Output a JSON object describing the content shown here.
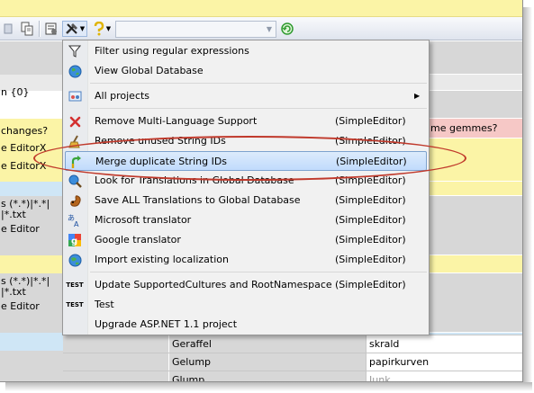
{
  "toolbar": {
    "combo_value": ""
  },
  "grid_left_texts": [
    "n {0}",
    "changes?",
    "e EditorX",
    "e EditorX",
    "s (*.*)|*.*|",
    "|*.txt",
    "e Editor",
    "s (*.*)|*.*|",
    "|*.txt",
    "e Editor"
  ],
  "right_column_text": "me gemmes?",
  "menu": {
    "items": [
      {
        "label": "Filter using regular expressions",
        "icon": "filter-icon",
        "shortcut": ""
      },
      {
        "label": "View Global Database",
        "icon": "globe-icon",
        "shortcut": ""
      },
      {
        "label": "All projects",
        "icon": "projects-icon",
        "shortcut": ""
      },
      {
        "label": "Remove Multi-Language Support",
        "icon": "red-x-icon",
        "shortcut": "(SimpleEditor)"
      },
      {
        "label": "Remove unused String IDs",
        "icon": "broom-icon",
        "shortcut": "(SimpleEditor)"
      },
      {
        "label": "Merge duplicate String IDs",
        "icon": "merge-arrow-icon",
        "shortcut": "(SimpleEditor)"
      },
      {
        "label": "Look for Translations in Global Database",
        "icon": "search-globe-icon",
        "shortcut": "(SimpleEditor)"
      },
      {
        "label": "Save ALL Translations to Global Database",
        "icon": "squirrel-icon",
        "shortcut": "(SimpleEditor)"
      },
      {
        "label": "Microsoft translator",
        "icon": "translate-icon",
        "shortcut": "(SimpleEditor)"
      },
      {
        "label": "Google translator",
        "icon": "google-icon",
        "shortcut": "(SimpleEditor)"
      },
      {
        "label": "Import existing localization",
        "icon": "import-globe-icon",
        "shortcut": "(SimpleEditor)"
      },
      {
        "label": "Update SupportedCultures and RootNamespace",
        "icon": "test-icon",
        "shortcut": "(SimpleEditor)"
      },
      {
        "label": "Test",
        "icon": "test-icon",
        "shortcut": ""
      },
      {
        "label": "Upgrade ASP.NET 1.1 project",
        "icon": "",
        "shortcut": ""
      }
    ],
    "test_icon_text": "TEST",
    "submenu_arrow": "▶"
  },
  "bottom_rows": [
    {
      "key": "Geraffel",
      "value": "skrald"
    },
    {
      "key": "Gelump",
      "value": "papirkurven"
    },
    {
      "key": "Glump",
      "value": "Junk"
    }
  ],
  "colors": {
    "banner": "#fbf4a6",
    "pink_row": "#f6c8c6",
    "yellow_row": "#fbf4a6",
    "blue_row": "#cfe6f6",
    "grey_row": "#d7d7d7",
    "highlight_circle": "#c0392b"
  }
}
